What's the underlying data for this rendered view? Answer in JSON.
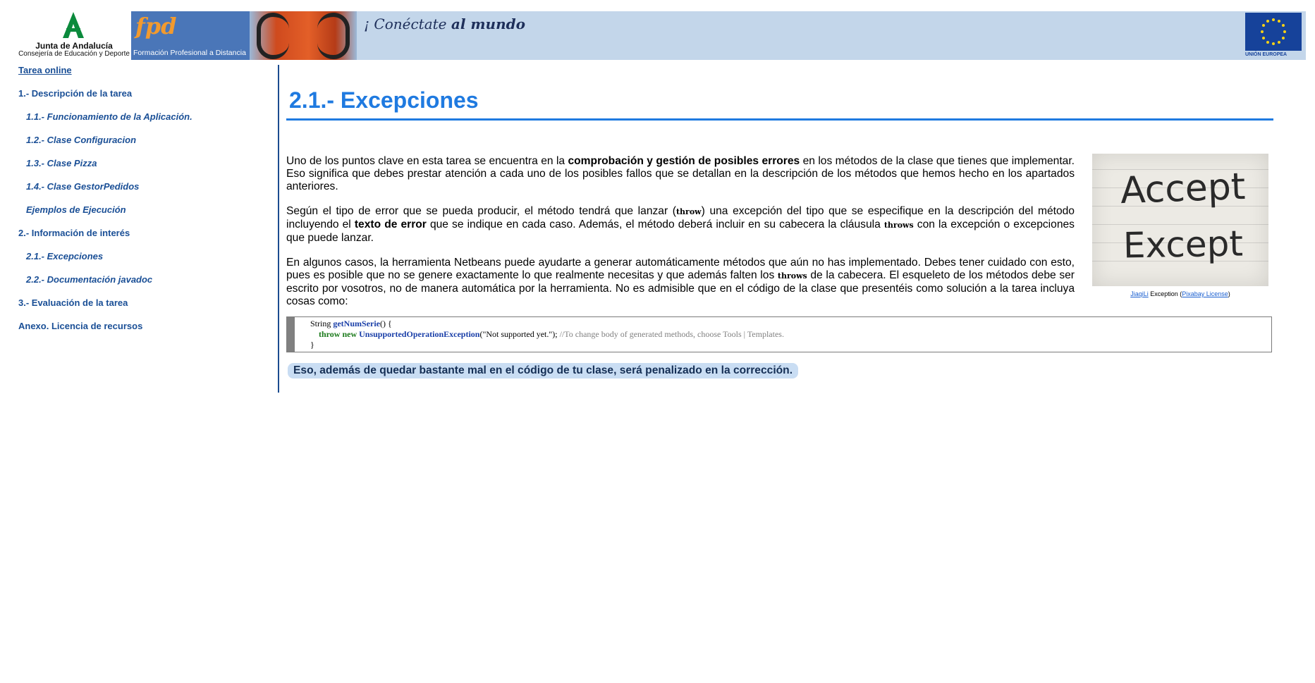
{
  "header": {
    "junta_name": "Junta de Andalucía",
    "junta_sub": "Consejería de Educación y Deporte",
    "fpd_logo": "fpd",
    "fpd_caption": "Formación Profesional a Distancia",
    "tagline_a": "¡ Conéctate ",
    "tagline_b": "al mundo",
    "eu_label": "UNIÓN EUROPEA"
  },
  "sidebar": {
    "items": [
      {
        "label": "Tarea online",
        "level": "top"
      },
      {
        "label": "1.- Descripción de la tarea",
        "level": "section"
      },
      {
        "label": "1.1.- Funcionamiento de la Aplicación.",
        "level": "sub"
      },
      {
        "label": "1.2.- Clase Configuracion",
        "level": "sub"
      },
      {
        "label": "1.3.- Clase Pizza",
        "level": "sub"
      },
      {
        "label": "1.4.- Clase GestorPedidos",
        "level": "sub"
      },
      {
        "label": "Ejemplos de Ejecución",
        "level": "sub"
      },
      {
        "label": "2.- Información de interés",
        "level": "section"
      },
      {
        "label": "2.1.- Excepciones",
        "level": "sub"
      },
      {
        "label": "2.2.- Documentación javadoc",
        "level": "sub"
      },
      {
        "label": "3.- Evaluación de la tarea",
        "level": "section"
      },
      {
        "label": "Anexo. Licencia de recursos",
        "level": "section"
      }
    ]
  },
  "main": {
    "title": "2.1.- Excepciones",
    "p1": {
      "a": "Uno de los puntos clave en esta tarea se encuentra en la ",
      "b": "comprobación y gestión de posibles errores",
      "c": " en los métodos de la clase que tienes que implementar. Eso significa que debes prestar atención a cada uno de los posibles fallos que se detallan en la descripción de los métodos que hemos hecho en los apartados anteriores."
    },
    "p2": {
      "a": "Según el tipo de error que se pueda producir, el método tendrá que lanzar (",
      "kw1": "throw",
      "b": ") una excepción del tipo que se especifique en la descripción del método incluyendo el ",
      "bold": "texto de error",
      "c": " que se indique en cada caso. Además, el método deberá incluir en su cabecera la cláusula ",
      "kw2": "throws",
      "d": " con la excepción o excepciones que puede lanzar."
    },
    "p3": {
      "a": "En algunos casos, la herramienta Netbeans puede ayudarte a generar automáticamente métodos que aún no has implementado. Debes tener cuidado con esto, pues es posible que no se genere exactamente lo que realmente necesitas y que además falten los ",
      "kw": "throws",
      "b": " de la cabecera. El esqueleto de los métodos debe ser escrito por vosotros, no de manera automática por la herramienta. No es admisible que en el código de la clase que presentéis como solución a la tarea incluya cosas como:"
    },
    "figure": {
      "word1": "Accept",
      "word2": "Except",
      "credit_author": "JiaqiLi",
      "credit_mid": " Exception (",
      "credit_license": "Pixabay License",
      "credit_end": ")"
    },
    "code": {
      "l1_type": "String ",
      "l1_fn": "getNumSerie",
      "l1_end": "() {",
      "l2_kw": "throw new ",
      "l2_cls": "UnsupportedOperationException",
      "l2_str": "(\"Not supported yet.\"); ",
      "l2_cmt": "//To change body of generated methods, choose Tools | Templates.",
      "l3": "}"
    },
    "note": "Eso, además de quedar bastante mal en el código de tu clase, será penalizado en la corrección."
  }
}
